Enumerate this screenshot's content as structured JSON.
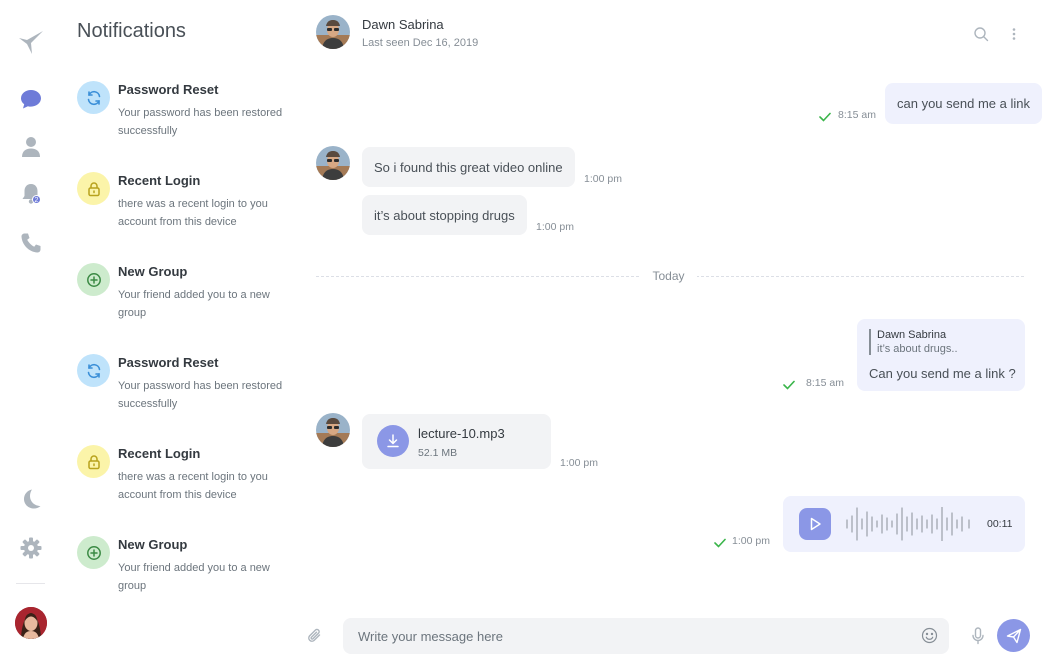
{
  "colors": {
    "accent": "#6e7bd8",
    "bubble_in": "#f2f3f5",
    "bubble_out": "#eff1fd",
    "check": "#3ab54a"
  },
  "icons": {
    "rail": [
      "bird-logo-icon",
      "chat-icon",
      "user-icon",
      "bell-icon",
      "phone-icon",
      "moon-icon",
      "gear-icon"
    ]
  },
  "nav": {
    "bell_badge": "2"
  },
  "notifications": {
    "title": "Notifications",
    "items": [
      {
        "type": "refresh-icon",
        "color": "#bfe3fb",
        "title": "Password Reset",
        "body": "Your password has been restored successfully"
      },
      {
        "type": "lock-icon",
        "color": "#fbf4a9",
        "title": "Recent Login",
        "body": "there was a recent login to you account from this device"
      },
      {
        "type": "plus-circle-icon",
        "color": "#cdebcd",
        "title": "New Group",
        "body": "Your friend added you to a new group"
      },
      {
        "type": "refresh-icon",
        "color": "#bfe3fb",
        "title": "Password Reset",
        "body": "Your password has been restored successfully"
      },
      {
        "type": "lock-icon",
        "color": "#fbf4a9",
        "title": "Recent Login",
        "body": "there was a recent login to you account from this device"
      },
      {
        "type": "plus-circle-icon",
        "color": "#cdebcd",
        "title": "New Group",
        "body": "Your friend added you to a new group"
      }
    ]
  },
  "chat": {
    "contact_name": "Dawn Sabrina",
    "last_seen": "Last seen Dec 16, 2019",
    "messages": {
      "m1_text": "can you send me a link",
      "m1_time": "8:15 am",
      "m2_text": "So i found this great video online",
      "m2_time": "1:00 pm",
      "m3_text": "it’s about stopping drugs",
      "m3_time": "1:00 pm",
      "divider": "Today",
      "reply_name": "Dawn Sabrina",
      "reply_text": "it’s about drugs..",
      "m4_text": "Can you send me a link ?",
      "m4_time": "8:15 am",
      "file_name": "lecture-10.mp3",
      "file_size": "52.1 MB",
      "file_time": "1:00 pm",
      "audio_duration": "00:11",
      "audio_time": "1:00 pm"
    },
    "composer_placeholder": "Write your message here"
  }
}
